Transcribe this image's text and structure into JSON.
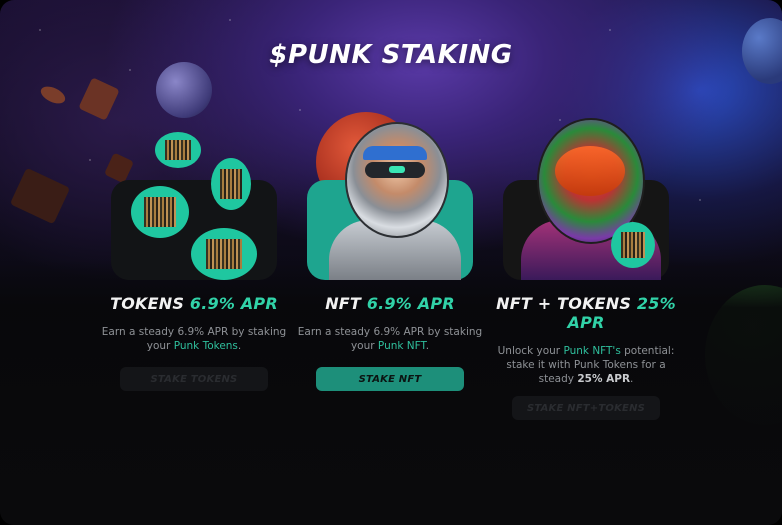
{
  "page": {
    "title": "$PUNK STAKING"
  },
  "colors": {
    "accent": "#31d2a8",
    "button_active": "#1d8f7a",
    "button_disabled": "#141518"
  },
  "cards": [
    {
      "title_main": "TOKENS",
      "title_apr": "6.9% APR",
      "desc_pre": "Earn a steady 6.9% APR by staking your ",
      "desc_link": "Punk Tokens",
      "desc_post": ".",
      "button_label": "STAKE TOKENS",
      "button_state": "disabled"
    },
    {
      "title_main": "NFT",
      "title_apr": "6.9% APR",
      "desc_pre": "Earn a steady 6.9% APR by staking your ",
      "desc_link": "Punk NFT",
      "desc_post": ".",
      "button_label": "STAKE NFT",
      "button_state": "active"
    },
    {
      "title_main": "NFT + TOKENS",
      "title_apr": "25% APR",
      "desc_pre": "Unlock your ",
      "desc_link": "Punk NFT's",
      "desc_mid": " potential: stake it with Punk Tokens for a steady ",
      "desc_bold": "25% APR",
      "desc_post": ".",
      "button_label": "STAKE NFT+TOKENS",
      "button_state": "disabled"
    }
  ]
}
